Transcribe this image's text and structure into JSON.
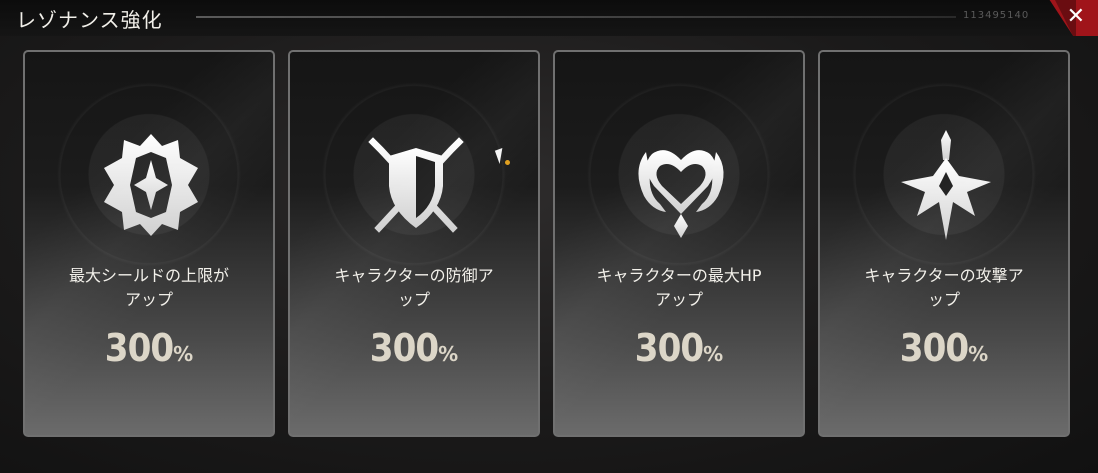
{
  "window": {
    "title": "レゾナンス強化",
    "code": "113495140",
    "close_icon": "close-icon"
  },
  "cards": [
    {
      "icon": "shield-emblem-icon",
      "line1": "最大シールドの上限が",
      "line2": "アップ",
      "value": "300",
      "unit": "%"
    },
    {
      "icon": "crossed-swords-shield-icon",
      "line1": "キャラクターの防御ア",
      "line2": "ップ",
      "value": "300",
      "unit": "%"
    },
    {
      "icon": "heart-emblem-icon",
      "line1": "キャラクターの最大HP",
      "line2": "アップ",
      "value": "300",
      "unit": "%"
    },
    {
      "icon": "sword-emblem-icon",
      "line1": "キャラクターの攻撃ア",
      "line2": "ップ",
      "value": "300",
      "unit": "%"
    }
  ],
  "colors": {
    "accent_red": "#a0141a",
    "value_text": "#dcd6c8",
    "panel_border": "#707070"
  }
}
